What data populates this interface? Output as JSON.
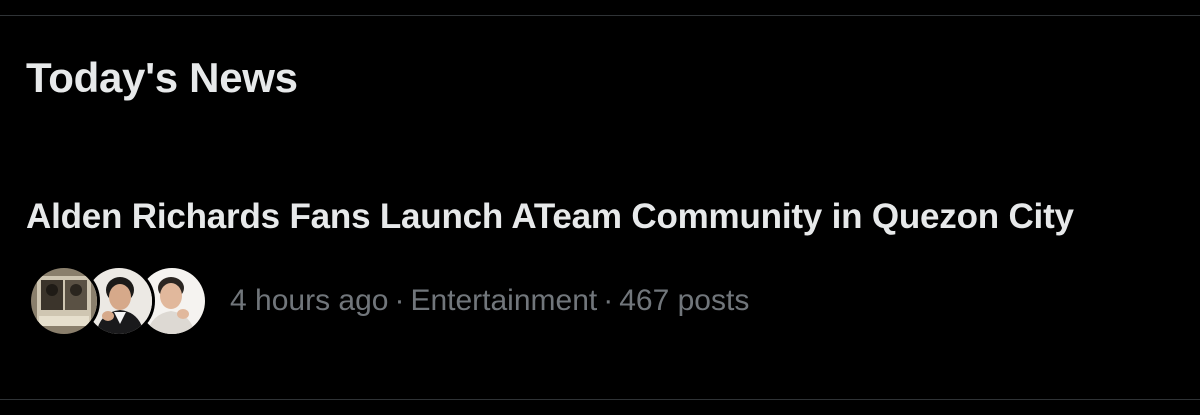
{
  "section": {
    "title": "Today's News"
  },
  "news_item": {
    "headline": "Alden Richards Fans Launch ATeam Community in Quezon City",
    "time": "4 hours ago",
    "category": "Entertainment",
    "posts": "467 posts",
    "separator": "·",
    "avatars": [
      "avatar-photo-1",
      "avatar-photo-2",
      "avatar-photo-3"
    ]
  },
  "colors": {
    "background": "#000000",
    "primary_text": "#e7e9ea",
    "secondary_text": "#71767b",
    "divider": "#2f3336"
  }
}
